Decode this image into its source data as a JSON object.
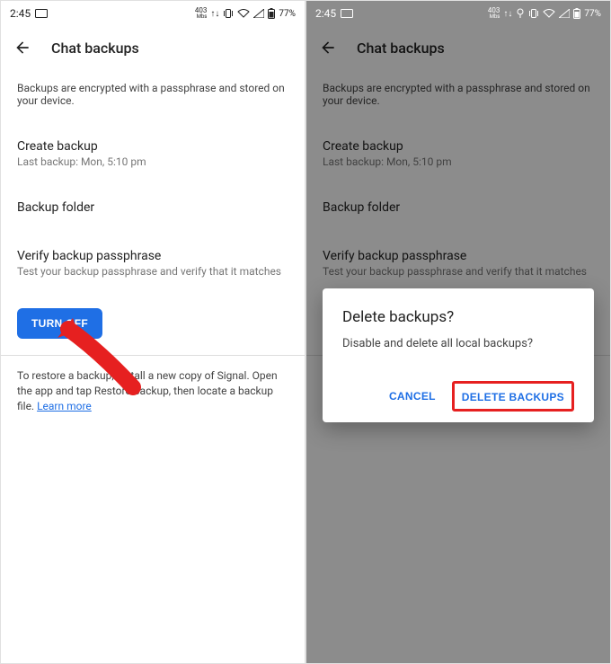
{
  "status": {
    "time": "2:45",
    "network_top": "403",
    "network_bottom": "Mbs",
    "battery": "77%"
  },
  "appbar": {
    "title": "Chat backups"
  },
  "subtitle": "Backups are encrypted with a passphrase and stored on your device.",
  "rows": {
    "create_backup": {
      "title": "Create backup",
      "sub": "Last backup: Mon, 5:10 pm"
    },
    "backup_folder": {
      "title": "Backup folder"
    },
    "verify": {
      "title": "Verify backup passphrase",
      "sub": "Test your backup passphrase and verify that it matches"
    }
  },
  "turn_off": "TURN OFF",
  "footnote_pre": "To restore a backup, install a new copy of Signal. Open the app and tap Restore backup, then locate a backup file. ",
  "footnote_link": "Learn more",
  "dialog": {
    "title": "Delete backups?",
    "message": "Disable and delete all local backups?",
    "cancel": "CANCEL",
    "confirm": "DELETE BACKUPS"
  }
}
